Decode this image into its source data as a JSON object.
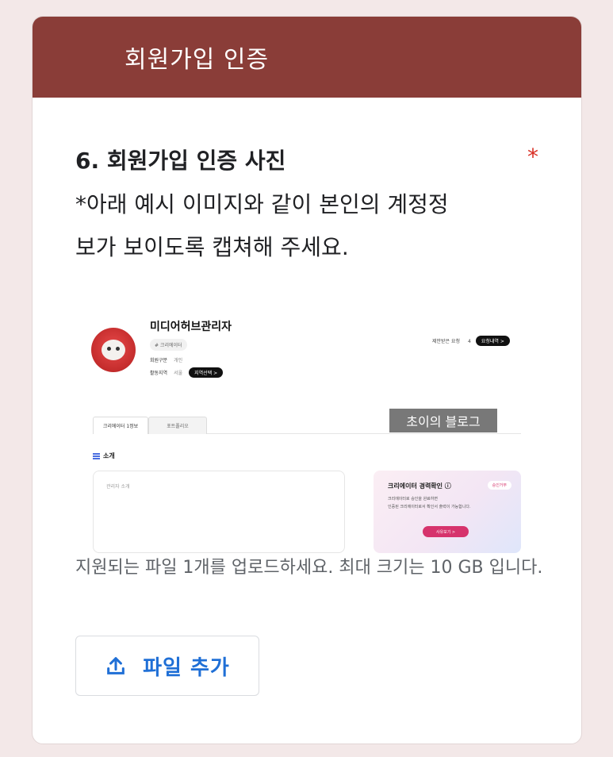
{
  "header": {
    "title": "회원가입 인증"
  },
  "question": {
    "title": "6. 회원가입 인증 사진",
    "required_mark": "*",
    "description_line1": "*아래 예시 이미지와 같이 본인의 계정정",
    "description_line2": "보가 보이도록 캡쳐해 주세요."
  },
  "example": {
    "profile_name": "미디어허브관리자",
    "tag": "# 크리에이터",
    "member_type_label": "회원구분",
    "member_type_value": "개인",
    "region_label": "활동지역",
    "region_value": "서울",
    "region_button": "지역선택 >",
    "requests_label": "제안받은 요청",
    "requests_count": "4",
    "requests_button": "요청내역 >",
    "tab1": "크리에이터 1정보",
    "tab2": "포트폴리오",
    "watermark": "초이의 블로그",
    "section_title": "소개",
    "intro_placeholder": "관리자 소개",
    "career_title": "크리에이터 경력확인 ⓘ",
    "career_status": "승인거부",
    "career_line1": "크리에이터로 승인을 완료하면",
    "career_line2": "인증된 크리에이터로서 확인서 출력이 가능합니다.",
    "career_button": "사유보기 >"
  },
  "upload": {
    "note": "지원되는 파일 1개를 업로드하세요. 최대 크기는 10 GB 입니다.",
    "button_label": "파일 추가"
  },
  "colors": {
    "header_bg": "#8a3d38",
    "accent_blue": "#1f6fd6",
    "required_red": "#d93025",
    "page_bg": "#f3e8e8"
  },
  "icons": {
    "upload": "upload-icon"
  }
}
